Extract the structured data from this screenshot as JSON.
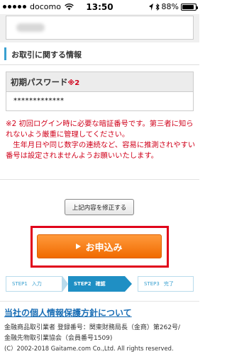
{
  "status_bar": {
    "carrier": "docomo",
    "time": "13:50",
    "battery": "88%",
    "battery_level": 0.88
  },
  "form": {
    "section_title": "お取引に関する情報",
    "password_label": "初期パスワード",
    "password_note": "※2",
    "password_value": "*************",
    "notice_line1": "※2 初回ログイン時に必要な暗証番号です。第三者に知られないよう厳重に管理してください。",
    "notice_line2": "　生年月日や同じ数字の連続など、容易に推測されやすい番号は設定されませんようお願いいたします。"
  },
  "actions": {
    "modify_label": "上記内容を修正する",
    "apply_label": "お申込み"
  },
  "steps": [
    {
      "num": "STEP1",
      "label": "入力"
    },
    {
      "num": "STEP2",
      "label": "確認"
    },
    {
      "num": "STEP3",
      "label": "完了"
    }
  ],
  "footer": {
    "privacy_link": "当社の個人情報保護方針について",
    "registration1": "金融商品取引業者 登録番号：関東財務局長（金商）第262号/",
    "registration2": "金融先物取引業協会（会員番号1509)",
    "copyright": "(C）2002-2018 Gaitame.com Co.,Ltd. All rights reserved."
  },
  "colors": {
    "accent": "#3aa0d0",
    "apply_button": "#f07a10",
    "highlight_frame": "#e0001a",
    "notice_text": "#d0021b"
  }
}
